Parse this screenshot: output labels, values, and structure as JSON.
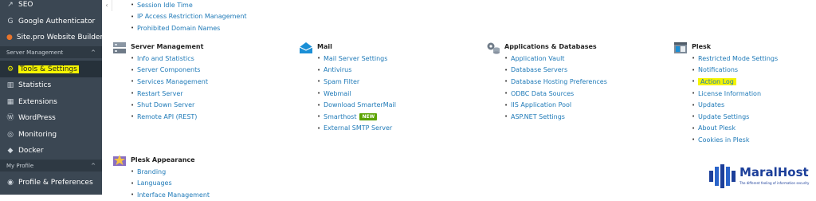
{
  "sidebar": {
    "items_top": [
      {
        "label": "SEO",
        "icon": "chart-icon"
      },
      {
        "label": "Google Authenticator",
        "icon": "google-icon"
      },
      {
        "label": "Site.pro Website Builder",
        "icon": "sitepro-icon"
      }
    ],
    "section_server": "Server Management",
    "items_server": [
      {
        "label": "Tools & Settings",
        "icon": "tools-icon"
      },
      {
        "label": "Statistics",
        "icon": "bar-chart-icon"
      },
      {
        "label": "Extensions",
        "icon": "puzzle-icon"
      },
      {
        "label": "WordPress",
        "icon": "wordpress-icon"
      },
      {
        "label": "Monitoring",
        "icon": "monitoring-icon"
      },
      {
        "label": "Docker",
        "icon": "docker-icon"
      }
    ],
    "section_profile": "My Profile",
    "items_profile": [
      {
        "label": "Profile & Preferences",
        "icon": "user-icon"
      }
    ],
    "collapse_glyph": "‹",
    "chevron_glyph": "^"
  },
  "security_links": [
    "Session Idle Time",
    "IP Access Restriction Management",
    "Prohibited Domain Names"
  ],
  "groups": {
    "server_management": {
      "title": "Server Management",
      "links": [
        "Info and Statistics",
        "Server Components",
        "Services Management",
        "Restart Server",
        "Shut Down Server",
        "Remote API (REST)"
      ]
    },
    "mail": {
      "title": "Mail",
      "links": [
        "Mail Server Settings",
        "Antivirus",
        "Spam Filter",
        "Webmail",
        "Download SmarterMail",
        "Smarthost",
        "External SMTP Server"
      ],
      "badge": "NEW"
    },
    "apps_db": {
      "title": "Applications & Databases",
      "links": [
        "Application Vault",
        "Database Servers",
        "Database Hosting Preferences",
        "ODBC Data Sources",
        "IIS Application Pool",
        "ASP.NET Settings"
      ]
    },
    "plesk": {
      "title": "Plesk",
      "links": [
        "Restricted Mode Settings",
        "Notifications",
        "Action Log",
        "License Information",
        "Updates",
        "Update Settings",
        "About Plesk",
        "Cookies in Plesk"
      ]
    },
    "appearance": {
      "title": "Plesk Appearance",
      "links": [
        "Branding",
        "Languages",
        "Interface Management"
      ]
    }
  },
  "bullet": "•",
  "logo": {
    "name": "MaralHost",
    "tagline": "The different feeling of information security"
  },
  "colors": {
    "sidebar": "#3b4753",
    "link": "#1f7ab8",
    "highlight": "#f4f400",
    "badge": "#5ba300",
    "logo": "#1c3f9a"
  }
}
